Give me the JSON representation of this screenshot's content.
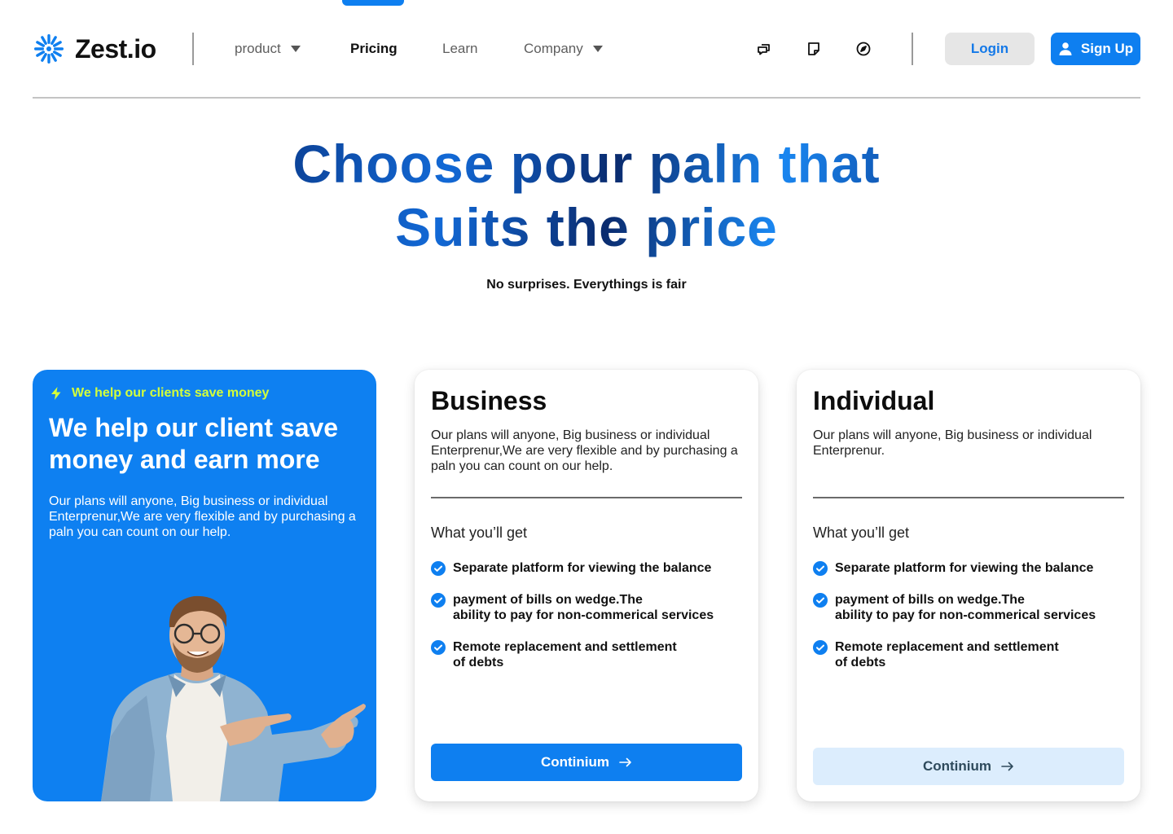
{
  "brand": {
    "name": "Zest.io",
    "logo_icon": "starburst-logo-icon"
  },
  "nav": {
    "items": [
      {
        "label": "product",
        "has_dropdown": true,
        "active": false
      },
      {
        "label": "Pricing",
        "has_dropdown": false,
        "active": true
      },
      {
        "label": "Learn",
        "has_dropdown": false,
        "active": false
      },
      {
        "label": "Company",
        "has_dropdown": true,
        "active": false
      }
    ],
    "icons": [
      "chat-bubbles-icon",
      "note-icon",
      "compass-icon"
    ],
    "login_label": "Login",
    "signup_label": "Sign Up"
  },
  "hero": {
    "title_line1": "Choose pour paln that",
    "title_line2": "Suits the price",
    "subtitle": "No surprises. Everythings is fair"
  },
  "promo": {
    "badge": "We help our clients save money",
    "title": "We help our client save money and earn more",
    "description": "Our plans will anyone, Big business or individual Enterprenur,We are very flexible and by purchasing a paln you can count on our help."
  },
  "plans": [
    {
      "name": "Business",
      "description": "Our plans will anyone, Big business or individual Enterprenur,We are very flexible and by purchasing a paln you can count on our help.",
      "features_heading": "What you’ll get",
      "features": [
        "Separate platform for viewing the balance",
        "payment of bills on wedge.The\nability to pay for non-commerical services",
        "Remote replacement and settlement\nof debts"
      ],
      "cta": "Continium"
    },
    {
      "name": "Individual",
      "description": "Our plans will anyone, Big business or individual Enterprenur.",
      "features_heading": "What you’ll get",
      "features": [
        "Separate platform for viewing the balance",
        "payment of bills on wedge.The\nability to pay for non-commerical services",
        "Remote replacement and settlement\nof debts"
      ],
      "cta": "Continium"
    }
  ],
  "colors": {
    "accent": "#0e7ff0",
    "badge": "#d4ff3a",
    "soft_button": "#dcedfd",
    "login_bg": "#e6e6e6"
  }
}
